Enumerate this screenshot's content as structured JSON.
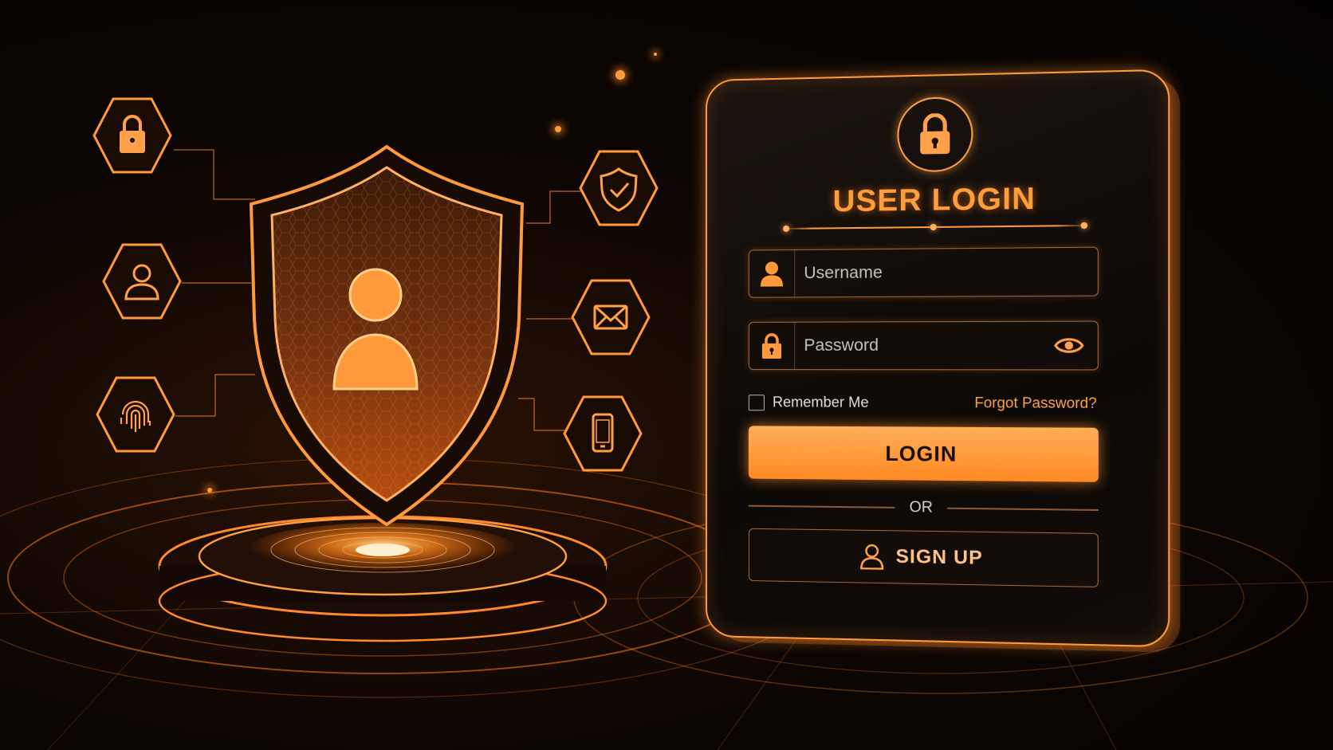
{
  "colors": {
    "accent": "#ff9a3c",
    "accent_light": "#ffb060",
    "background": "#0a0503",
    "button_text": "#1a0e06"
  },
  "illustration": {
    "left_icons": [
      "lock-icon",
      "user-icon",
      "fingerprint-icon"
    ],
    "right_icons": [
      "shield-check-icon",
      "envelope-icon",
      "mobile-phone-icon"
    ],
    "center_icon": "user-icon"
  },
  "login_card": {
    "header_icon": "lock-icon",
    "title": "USER LOGIN",
    "username": {
      "icon": "user-icon",
      "placeholder": "Username",
      "value": ""
    },
    "password": {
      "icon": "lock-icon",
      "placeholder": "Password",
      "value": "",
      "toggle_icon": "eye-icon"
    },
    "remember_me": {
      "label": "Remember Me",
      "checked": false
    },
    "forgot_password": "Forgot Password?",
    "login_button": "LOGIN",
    "divider": "OR",
    "signup_button": {
      "icon": "user-icon",
      "label": "SIGN UP"
    }
  }
}
